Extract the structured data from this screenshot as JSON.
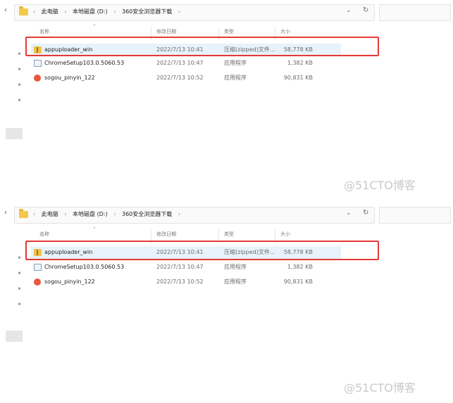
{
  "panels": [
    {
      "breadcrumbs": [
        "此电脑",
        "本地磁盘 (D:)",
        "360安全浏览器下载"
      ],
      "columns": {
        "name": "名称",
        "date": "修改日期",
        "type": "类型",
        "size": "大小"
      },
      "files": [
        {
          "name": "appuploader_win",
          "date": "2022/7/13 10:41",
          "type": "压缩(zipped)文件...",
          "size": "58,778 KB",
          "icon": "zip-folder-icon",
          "selected": true
        },
        {
          "name": "ChromeSetup103.0.5060.53",
          "date": "2022/7/13 10:47",
          "type": "应用程序",
          "size": "1,382 KB",
          "icon": "chrome-setup-icon",
          "selected": false
        },
        {
          "name": "sogou_pinyin_122",
          "date": "2022/7/13 10:52",
          "type": "应用程序",
          "size": "90,831 KB",
          "icon": "sogou-icon",
          "selected": false
        }
      ],
      "watermark": "@51CTO博客"
    },
    {
      "breadcrumbs": [
        "此电脑",
        "本地磁盘 (D:)",
        "360安全浏览器下载"
      ],
      "columns": {
        "name": "名称",
        "date": "修改日期",
        "type": "类型",
        "size": "大小"
      },
      "files": [
        {
          "name": "appuploader_win",
          "date": "2022/7/13 10:41",
          "type": "压缩(zipped)文件...",
          "size": "58,778 KB",
          "icon": "zip-folder-icon",
          "selected": true
        },
        {
          "name": "ChromeSetup103.0.5060.53",
          "date": "2022/7/13 10:47",
          "type": "应用程序",
          "size": "1,382 KB",
          "icon": "chrome-setup-icon",
          "selected": false
        },
        {
          "name": "sogou_pinyin_122",
          "date": "2022/7/13 10:52",
          "type": "应用程序",
          "size": "90,831 KB",
          "icon": "sogou-icon",
          "selected": false
        }
      ],
      "watermark": "@51CTO博客"
    }
  ],
  "highlight_color": "#e53935",
  "selection_color": "#e8f2fb"
}
